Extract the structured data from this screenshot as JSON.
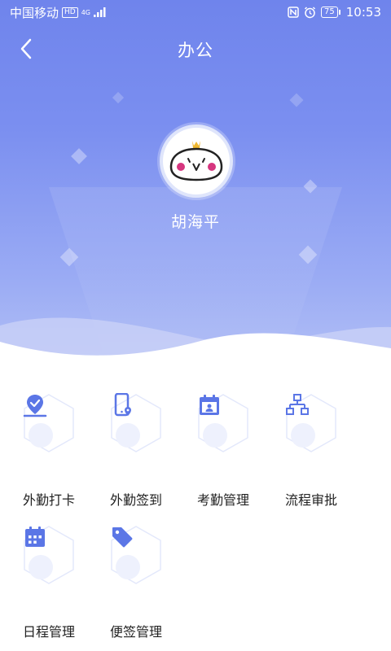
{
  "status_bar": {
    "carrier": "中国移动",
    "hd_badge": "HD",
    "network": "4G",
    "battery": "75",
    "time": "10:53"
  },
  "header": {
    "title": "办公"
  },
  "user": {
    "name": "胡海平"
  },
  "colors": {
    "accent": "#5b76e6",
    "hero_top": "#6f84ec",
    "hero_bottom": "#b3c0f6"
  },
  "menu": {
    "items": [
      {
        "label": "外勤打卡",
        "icon": "location-check-icon"
      },
      {
        "label": "外勤签到",
        "icon": "phone-location-icon"
      },
      {
        "label": "考勤管理",
        "icon": "calendar-person-icon"
      },
      {
        "label": "流程审批",
        "icon": "flowchart-icon"
      },
      {
        "label": "日程管理",
        "icon": "calendar-grid-icon"
      },
      {
        "label": "便签管理",
        "icon": "tag-icon"
      }
    ]
  }
}
